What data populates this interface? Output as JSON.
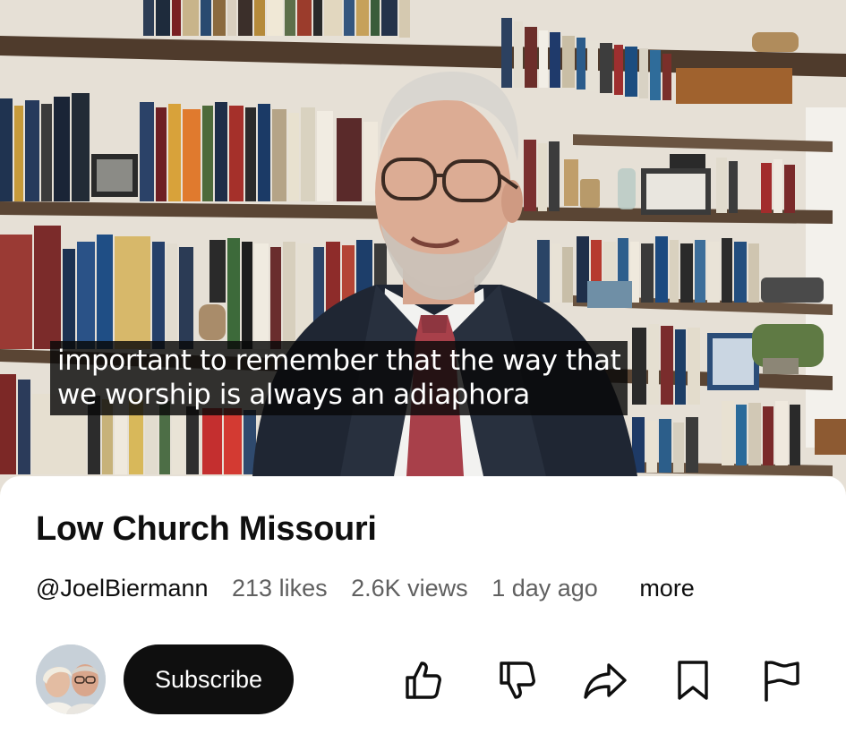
{
  "video": {
    "caption_lines": [
      "important to remember that the way that",
      "we worship is always an adiaphora"
    ]
  },
  "details": {
    "title": "Low Church Missouri",
    "channel_handle": "@JoelBiermann",
    "likes": "213 likes",
    "views": "2.6K views",
    "age": "1 day ago",
    "more_label": "more"
  },
  "actions": {
    "subscribe_label": "Subscribe",
    "icons": [
      "thumbs-up-icon",
      "thumbs-down-icon",
      "share-icon",
      "bookmark-icon",
      "flag-icon"
    ]
  },
  "colors": {
    "primary_text": "#0f0f0f",
    "secondary_text": "#606060",
    "subscribe_bg": "#0f0f0f",
    "caption_bg": "#080808"
  }
}
